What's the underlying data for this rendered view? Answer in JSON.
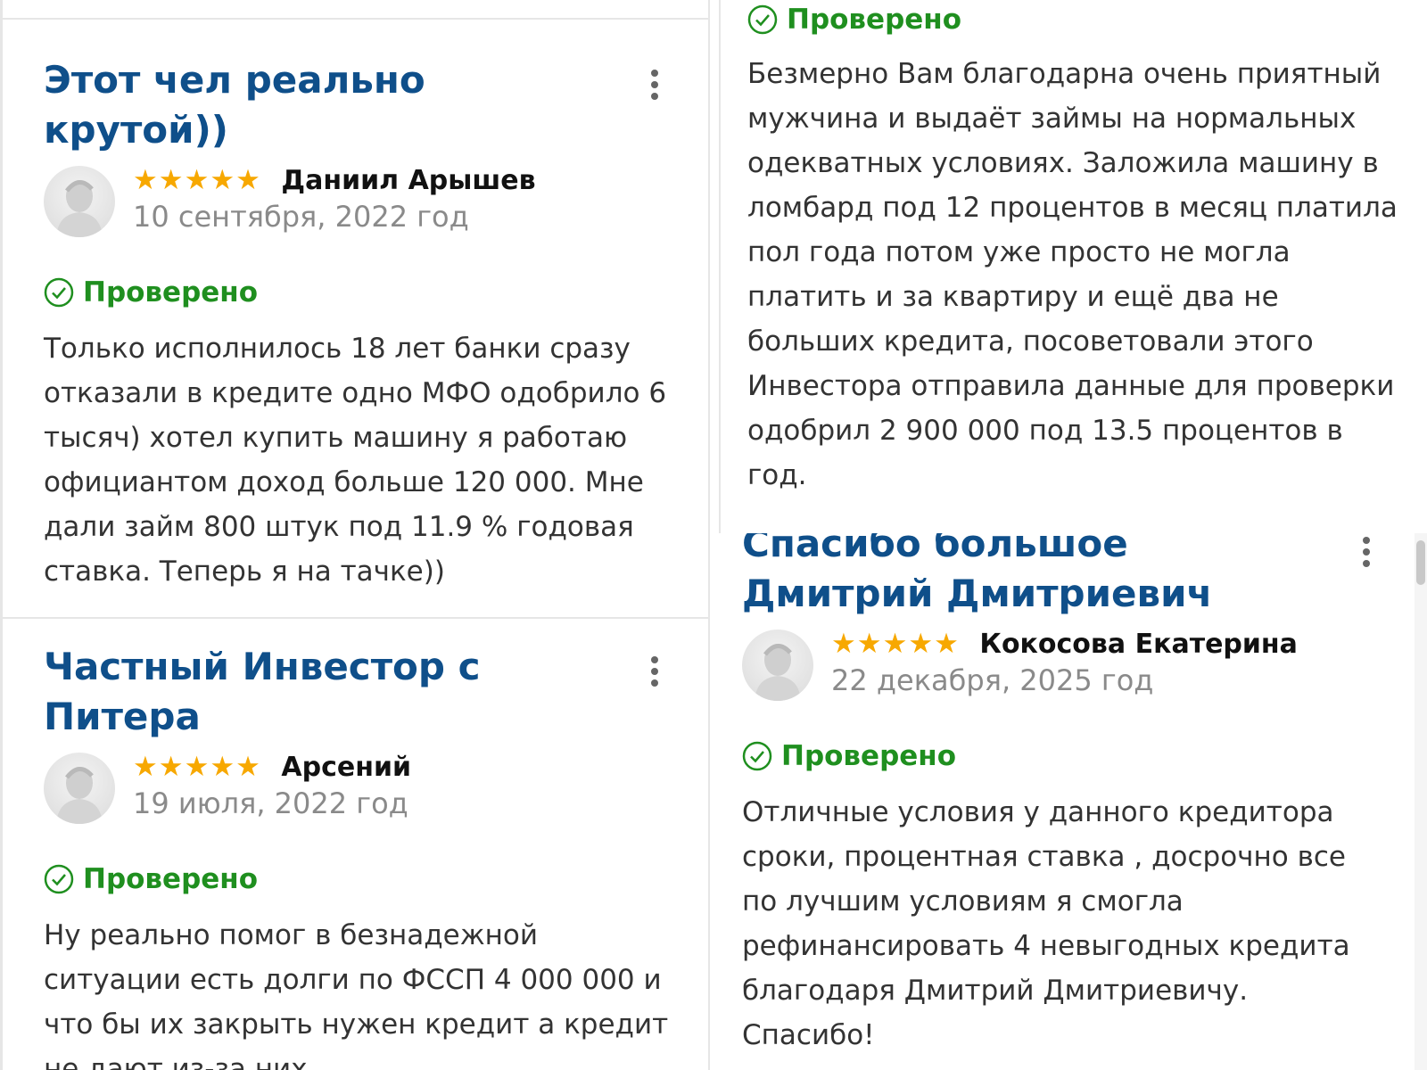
{
  "reviews": [
    {
      "title": "Этот чел реально крутой))",
      "author": "Даниил Арышев",
      "rating": 5,
      "stars": "★★★★★",
      "date": "10 сентября, 2022 год",
      "verified": "Проверено",
      "text": "Только исполнилось 18 лет банки сразу отказали в кредите одно МФО одобрило 6 тысяч) хотел купить машину я работаю официантом доход больше 120 000. Мне дали займ 800 штук под 11.9 % годовая ставка. Теперь я на тачке))"
    },
    {
      "title": "Частный Инвестор с Питера",
      "author": "Арсений",
      "rating": 5,
      "stars": "★★★★★",
      "date": "19 июля, 2022 год",
      "verified": "Проверено",
      "text": "Ну реально помог в безнадежной ситуации есть долги по ФССП 4 000 000 и что бы их закрыть нужен кредит а кредит не дают из-за них."
    },
    {
      "verified": "Проверено",
      "text": "Безмерно Вам благодарна очень приятный мужчина и выдаёт займы на нормальных одекватных условиях. Заложила машину в ломбард под 12 процентов в месяц платила пол года потом уже просто не могла платить и за квартиру и ещё два не больших кредита, посоветовали этого Инвестора отправила данные для проверки одобрил 2 900 000 под 13.5 процентов в год."
    },
    {
      "title": "Спасибо большое Дмитрий Дмитриевич",
      "author": "Кокосова Екатерина",
      "rating": 5,
      "stars": "★★★★★",
      "date": "22 декабря, 2025 год",
      "verified": "Проверено",
      "text": "Отличные условия у данного кредитора сроки, процентная ставка , досрочно все по лучшим условиям я смогла рефинансировать 4 невыгодных кредита благодаря Дмитрий Дмитриевичу. Спасибо!"
    }
  ],
  "colors": {
    "title": "#0f4f8a",
    "star": "#f7a800",
    "verified": "#1f8f1f",
    "date": "#8a8a8a"
  },
  "icons": {
    "avatar": "user-avatar-icon",
    "verified": "check-circle-icon",
    "menu": "more-vertical-icon"
  }
}
